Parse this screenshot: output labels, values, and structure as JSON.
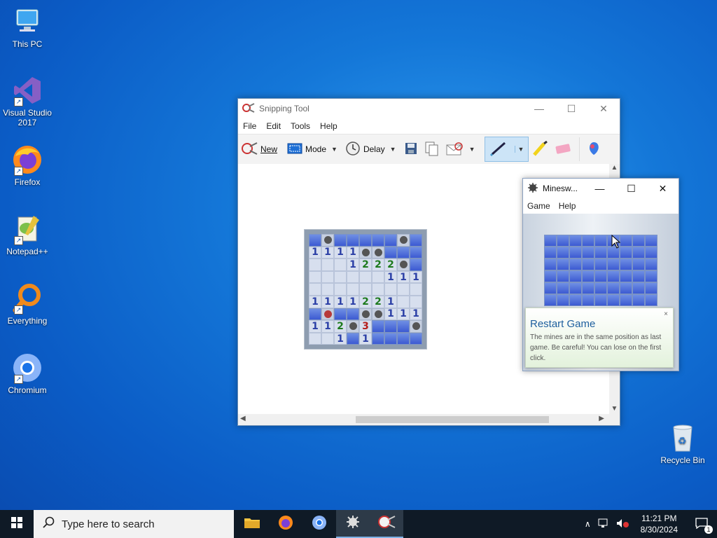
{
  "desktop": {
    "icons": [
      {
        "label": "This PC",
        "icon": "monitor-icon"
      },
      {
        "label": "Visual Studio 2017",
        "icon": "visual-studio-icon"
      },
      {
        "label": "Firefox",
        "icon": "firefox-icon"
      },
      {
        "label": "Notepad++",
        "icon": "notepadpp-icon"
      },
      {
        "label": "Everything",
        "icon": "everything-search-icon"
      },
      {
        "label": "Chromium",
        "icon": "chromium-icon"
      }
    ],
    "recycle_bin": "Recycle Bin"
  },
  "snipping": {
    "title": "Snipping Tool",
    "menu": [
      "File",
      "Edit",
      "Tools",
      "Help"
    ],
    "toolbar": {
      "new": "New",
      "mode": "Mode",
      "delay": "Delay"
    },
    "board": [
      "c m c c c c c m c",
      "1 1 1 1 m m c c c",
      "o o o 1 2 2 2 m c",
      "o o o o o o 1 1 1",
      "o o o o o o o o o",
      "1 1 1 1 2 2 1 o o",
      "c r c c m m 1 1 1",
      "1 1 2 m 3 c c c m",
      "o o 1 c 1 c c c c"
    ]
  },
  "minesweeper": {
    "title": "Minesw...",
    "menu": [
      "Game",
      "Help"
    ],
    "toast": {
      "title": "Restart Game",
      "body": "The mines are in the same position as last game. Be careful! You can lose on the first click.",
      "close": "×"
    }
  },
  "taskbar": {
    "search_placeholder": "Type here to search",
    "time": "11:21 PM",
    "date": "8/30/2024",
    "notification_count": "1"
  }
}
